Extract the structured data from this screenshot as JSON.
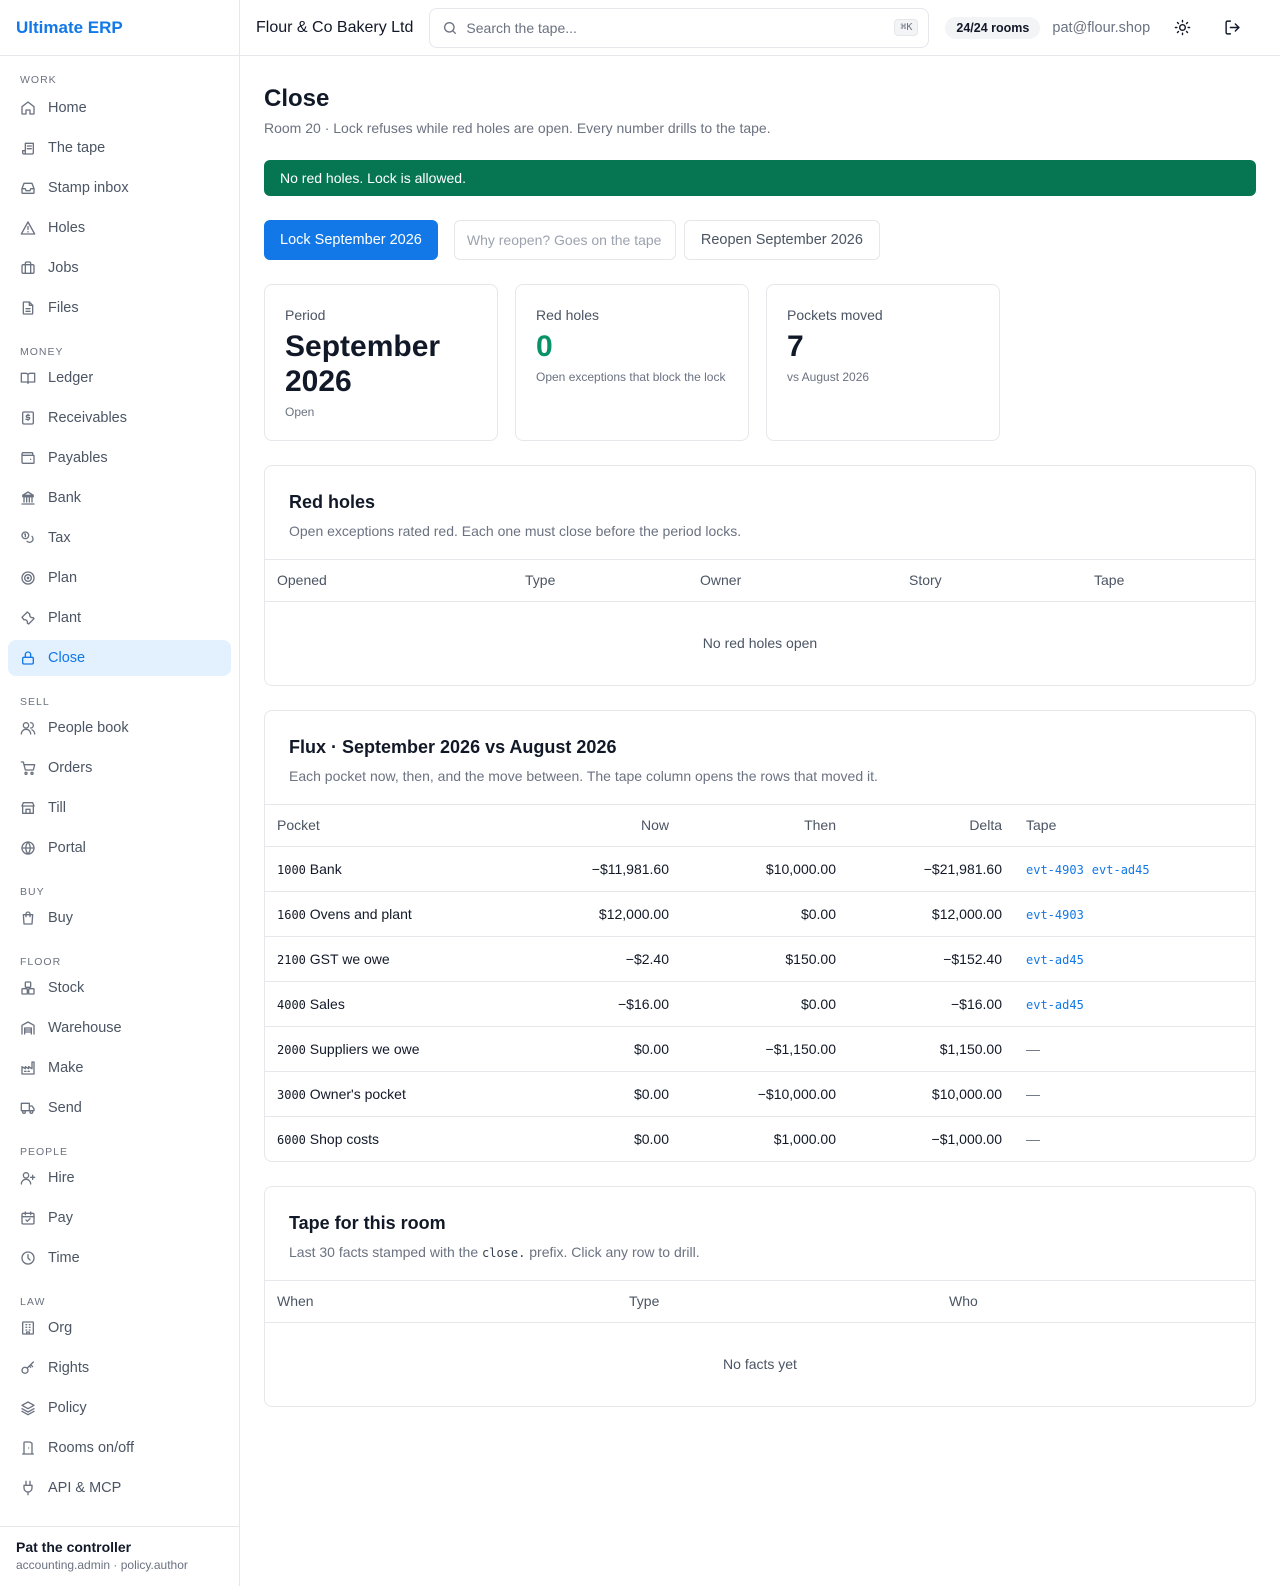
{
  "app": {
    "name": "Ultimate ERP"
  },
  "sidebar": {
    "sections": [
      {
        "label": "Work",
        "items": [
          {
            "label": "Home",
            "icon": "home-icon"
          },
          {
            "label": "The tape",
            "icon": "scroll-icon"
          },
          {
            "label": "Stamp inbox",
            "icon": "inbox-icon"
          },
          {
            "label": "Holes",
            "icon": "warning-icon"
          },
          {
            "label": "Jobs",
            "icon": "briefcase-icon"
          },
          {
            "label": "Files",
            "icon": "file-icon"
          }
        ]
      },
      {
        "label": "Money",
        "items": [
          {
            "label": "Ledger",
            "icon": "book-icon"
          },
          {
            "label": "Receivables",
            "icon": "receipt-icon"
          },
          {
            "label": "Payables",
            "icon": "wallet-icon"
          },
          {
            "label": "Bank",
            "icon": "bank-icon"
          },
          {
            "label": "Tax",
            "icon": "coins-icon"
          },
          {
            "label": "Plan",
            "icon": "target-icon"
          },
          {
            "label": "Plant",
            "icon": "wrench-icon"
          },
          {
            "label": "Close",
            "icon": "lock-icon",
            "active": true
          }
        ]
      },
      {
        "label": "Sell",
        "items": [
          {
            "label": "People book",
            "icon": "users-icon"
          },
          {
            "label": "Orders",
            "icon": "cart-icon"
          },
          {
            "label": "Till",
            "icon": "store-icon"
          },
          {
            "label": "Portal",
            "icon": "globe-icon"
          }
        ]
      },
      {
        "label": "Buy",
        "items": [
          {
            "label": "Buy",
            "icon": "shopping-bag-icon"
          }
        ]
      },
      {
        "label": "Floor",
        "items": [
          {
            "label": "Stock",
            "icon": "boxes-icon"
          },
          {
            "label": "Warehouse",
            "icon": "warehouse-icon"
          },
          {
            "label": "Make",
            "icon": "factory-icon"
          },
          {
            "label": "Send",
            "icon": "truck-icon"
          }
        ]
      },
      {
        "label": "People",
        "items": [
          {
            "label": "Hire",
            "icon": "user-plus-icon"
          },
          {
            "label": "Pay",
            "icon": "calendar-check-icon"
          },
          {
            "label": "Time",
            "icon": "clock-icon"
          }
        ]
      },
      {
        "label": "Law",
        "items": [
          {
            "label": "Org",
            "icon": "building-icon"
          },
          {
            "label": "Rights",
            "icon": "key-icon"
          },
          {
            "label": "Policy",
            "icon": "layers-icon"
          },
          {
            "label": "Rooms on/off",
            "icon": "door-icon"
          },
          {
            "label": "API & MCP",
            "icon": "plug-icon"
          }
        ]
      }
    ],
    "user": {
      "name": "Pat the controller",
      "roles": "accounting.admin · policy.author"
    }
  },
  "topbar": {
    "org": "Flour & Co Bakery Ltd",
    "search_placeholder": "Search the tape...",
    "shortcut": "⌘K",
    "rooms": "24/24 rooms",
    "email": "pat@flour.shop"
  },
  "page": {
    "title": "Close",
    "subtitle": "Room 20 · Lock refuses while red holes are open. Every number drills to the tape.",
    "banner": "No red holes. Lock is allowed.",
    "lock_button": "Lock September 2026",
    "reason_placeholder": "Why reopen? Goes on the tape",
    "reopen_button": "Reopen September 2026"
  },
  "stats": {
    "period": {
      "label": "Period",
      "value": "September 2026",
      "note": "Open"
    },
    "red_holes": {
      "label": "Red holes",
      "value": "0",
      "note": "Open exceptions that block the lock"
    },
    "pockets": {
      "label": "Pockets moved",
      "value": "7",
      "note": "vs August 2026"
    }
  },
  "red_holes": {
    "title": "Red holes",
    "desc": "Open exceptions rated red. Each one must close before the period locks.",
    "columns": [
      "Opened",
      "Type",
      "Owner",
      "Story",
      "Tape"
    ],
    "empty": "No red holes open"
  },
  "flux": {
    "title": "Flux · September 2026 vs August 2026",
    "desc": "Each pocket now, then, and the move between. The tape column opens the rows that moved it.",
    "columns": [
      "Pocket",
      "Now",
      "Then",
      "Delta",
      "Tape"
    ],
    "rows": [
      {
        "code": "1000",
        "name": "Bank",
        "now": "−$11,981.60",
        "then": "$10,000.00",
        "delta": "−$21,981.60",
        "tape": [
          "evt-4903",
          "evt-ad45"
        ]
      },
      {
        "code": "1600",
        "name": "Ovens and plant",
        "now": "$12,000.00",
        "then": "$0.00",
        "delta": "$12,000.00",
        "tape": [
          "evt-4903"
        ]
      },
      {
        "code": "2100",
        "name": "GST we owe",
        "now": "−$2.40",
        "then": "$150.00",
        "delta": "−$152.40",
        "tape": [
          "evt-ad45"
        ]
      },
      {
        "code": "4000",
        "name": "Sales",
        "now": "−$16.00",
        "then": "$0.00",
        "delta": "−$16.00",
        "tape": [
          "evt-ad45"
        ]
      },
      {
        "code": "2000",
        "name": "Suppliers we owe",
        "now": "$0.00",
        "then": "−$1,150.00",
        "delta": "$1,150.00",
        "tape": []
      },
      {
        "code": "3000",
        "name": "Owner's pocket",
        "now": "$0.00",
        "then": "−$10,000.00",
        "delta": "$10,000.00",
        "tape": []
      },
      {
        "code": "6000",
        "name": "Shop costs",
        "now": "$0.00",
        "then": "$1,000.00",
        "delta": "−$1,000.00",
        "tape": []
      }
    ],
    "no_tape": "—"
  },
  "room_tape": {
    "title": "Tape for this room",
    "desc_before": "Last 30 facts stamped with the",
    "desc_code": "close.",
    "desc_after": "prefix. Click any row to drill.",
    "columns": [
      "When",
      "Type",
      "Who"
    ],
    "empty": "No facts yet"
  }
}
